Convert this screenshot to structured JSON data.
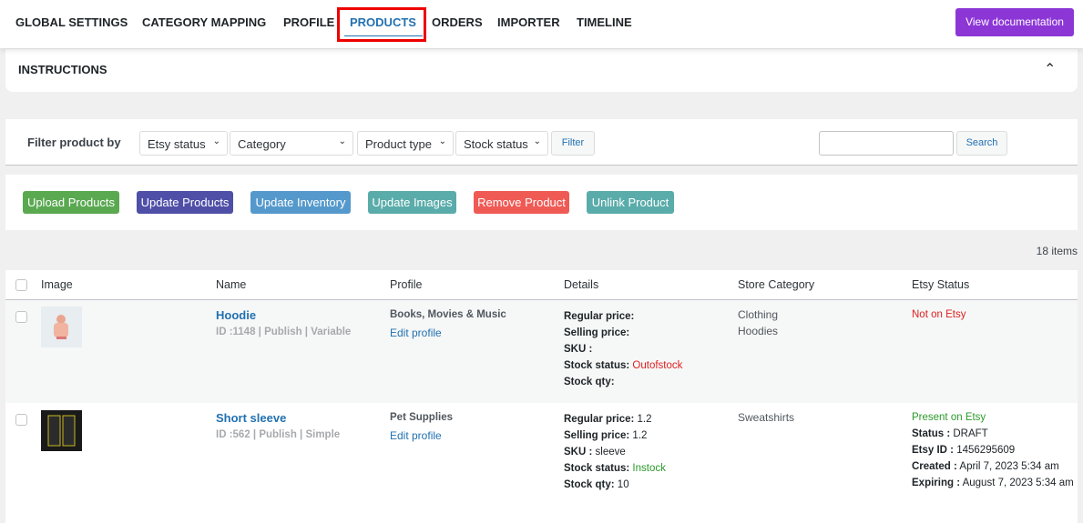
{
  "nav": {
    "items": [
      "GLOBAL SETTINGS",
      "CATEGORY MAPPING",
      "PROFILE",
      "PRODUCTS",
      "ORDERS",
      "IMPORTER",
      "TIMELINE"
    ],
    "active": "PRODUCTS",
    "doc_button": "View documentation"
  },
  "instructions": {
    "title": "INSTRUCTIONS"
  },
  "filter": {
    "label": "Filter product by",
    "selects": [
      "Etsy status",
      "Category",
      "Product type",
      "Stock status"
    ],
    "filter_button": "Filter",
    "search_value": "",
    "search_button": "Search"
  },
  "actions": [
    {
      "label": "Upload Products",
      "color": "#5aa951"
    },
    {
      "label": "Update Products",
      "color": "#4f4fa8"
    },
    {
      "label": "Update Inventory",
      "color": "#5599cc"
    },
    {
      "label": "Update Images",
      "color": "#5aacaa"
    },
    {
      "label": "Remove Product",
      "color": "#f05a55"
    },
    {
      "label": "Unlink Product",
      "color": "#5aacaa"
    }
  ],
  "item_count": "18 items",
  "table": {
    "headers": [
      "Image",
      "Name",
      "Profile",
      "Details",
      "Store Category",
      "Etsy Status"
    ],
    "rows": [
      {
        "name": "Hoodie",
        "meta": "ID :1148 | Publish | Variable",
        "profile": "Books, Movies & Music",
        "edit": "Edit profile",
        "details": {
          "regular_label": "Regular price:",
          "regular": "",
          "selling_label": "Selling price:",
          "selling": "",
          "sku_label": "SKU :",
          "sku": "",
          "stock_label": "Stock status:",
          "stock": "Outofstock",
          "qty_label": "Stock qty:",
          "qty": ""
        },
        "categories": [
          "Clothing",
          "Hoodies"
        ],
        "etsy_status": "Not on Etsy"
      },
      {
        "name": "Short sleeve",
        "meta": "ID :562 | Publish | Simple",
        "profile": "Pet Supplies",
        "edit": "Edit profile",
        "details": {
          "regular_label": "Regular price:",
          "regular": "1.2",
          "selling_label": "Selling price:",
          "selling": "1.2",
          "sku_label": "SKU :",
          "sku": "sleeve",
          "stock_label": "Stock status:",
          "stock": "Instock",
          "qty_label": "Stock qty:",
          "qty": "10"
        },
        "categories": [
          "Sweatshirts"
        ],
        "etsy_status": "Present on Etsy",
        "etsy": {
          "status_label": "Status :",
          "status": "DRAFT",
          "id_label": "Etsy ID :",
          "id": "1456295609",
          "created_label": "Created :",
          "created": "April 7, 2023 5:34 am",
          "expiring_label": "Expiring :",
          "expiring": "August 7, 2023 5:34 am"
        }
      }
    ]
  }
}
